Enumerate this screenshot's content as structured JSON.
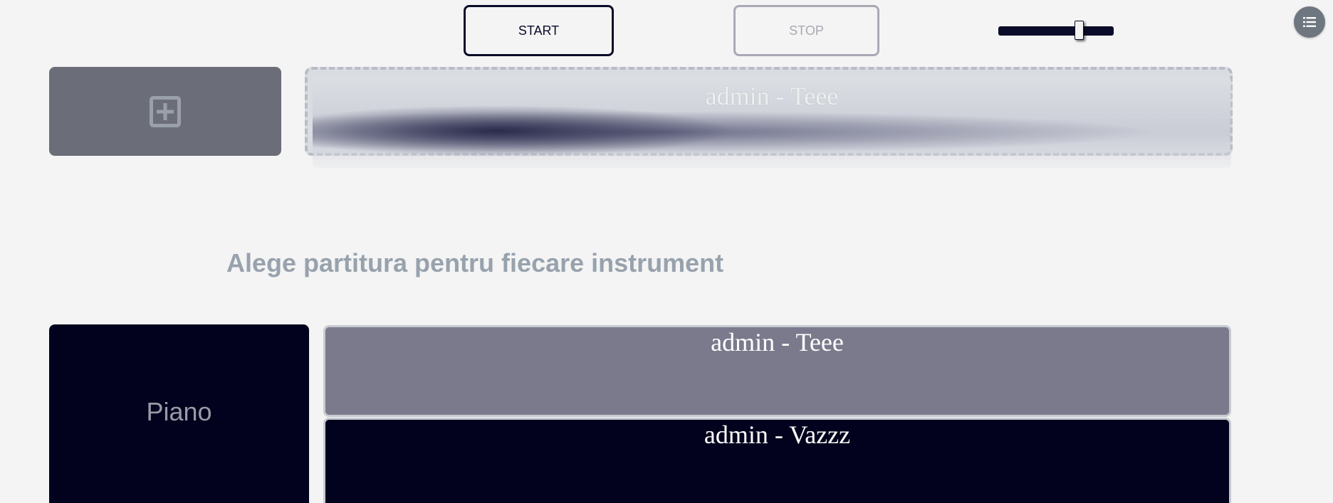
{
  "controls": {
    "start_label": "START",
    "stop_label": "STOP",
    "tempo_level": 0.72
  },
  "menu": {
    "icon": "list-icon"
  },
  "add_panel": {
    "icon": "plus-square-icon"
  },
  "dropzone": {
    "item_label": "admin - Teee"
  },
  "section": {
    "title": "Alege partitura pentru fiecare instrument"
  },
  "instrument": {
    "name": "Piano",
    "scores": [
      {
        "label": "admin - Teee"
      },
      {
        "label": "admin - Vazzz"
      }
    ]
  },
  "colors": {
    "background": "#f4f4f4",
    "navy": "#02021e",
    "muted_title": "#98a2ad",
    "selected_score": "#7b7a8d"
  }
}
